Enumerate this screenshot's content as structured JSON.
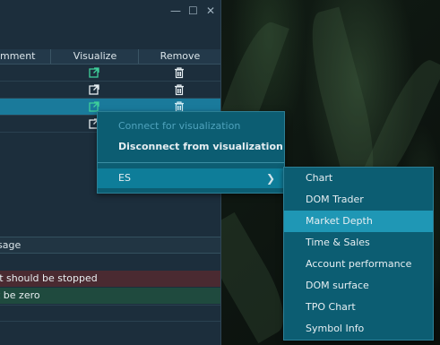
{
  "window": {
    "minimize": "—",
    "maximize": "☐",
    "close": "✕"
  },
  "grid": {
    "columns": [
      "mment",
      "Visualize",
      "Remove"
    ],
    "rows": [
      {
        "visualize_icon": "external-link-icon",
        "remove_icon": "trash-icon",
        "selected": false,
        "active": true
      },
      {
        "visualize_icon": "external-link-icon",
        "remove_icon": "trash-icon",
        "selected": false,
        "active": false
      },
      {
        "visualize_icon": "external-link-icon",
        "remove_icon": "trash-icon",
        "selected": true,
        "active": true
      },
      {
        "visualize_icon": "external-link-icon",
        "remove_icon": "",
        "selected": false,
        "active": false
      }
    ]
  },
  "log": {
    "header": "sage",
    "messages": [
      {
        "text": "It should be stopped",
        "level": "error",
        "color": "#4a2a31"
      },
      {
        "text": "t be zero",
        "level": "ok",
        "color": "#1f4a3e"
      }
    ]
  },
  "context_menu": {
    "connect": "Connect for visualization",
    "disconnect": "Disconnect from visualization",
    "instrument": "ES",
    "arrow": "❯"
  },
  "submenu": {
    "items": [
      "Chart",
      "DOM Trader",
      "Market Depth",
      "Time & Sales",
      "Account performance",
      "DOM surface",
      "TPO Chart",
      "Symbol Info"
    ],
    "active_index": 2
  },
  "colors": {
    "accent": "#1f97b5",
    "selected_row": "#1a7a9b",
    "icon_active": "#3ecf9a"
  }
}
